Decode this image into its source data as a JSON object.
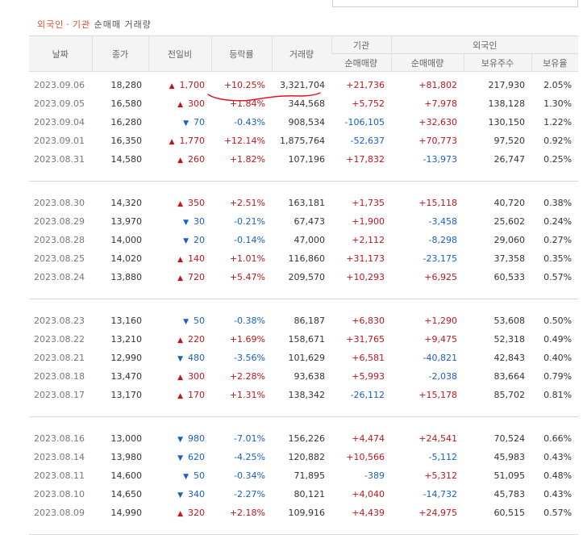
{
  "caption": {
    "part1": "외국인",
    "sep": "·",
    "part2": "기관",
    "rest": "순매매 거래량"
  },
  "columns": {
    "date": "날짜",
    "close": "종가",
    "change": "전일비",
    "rate": "등락률",
    "volume": "거래량",
    "inst_group": "기관",
    "inst_net": "순매매량",
    "foreign_group": "외국인",
    "foreign_net": "순매매량",
    "foreign_hold": "보유주수",
    "foreign_ratio": "보유율"
  },
  "groups": [
    [
      {
        "date": "2023.09.06",
        "close": "18,280",
        "dir": "up",
        "change": "1,700",
        "rate": "+10.25%",
        "volume": "3,321,704",
        "inst": "+21,736",
        "foreign": "+81,802",
        "hold": "217,930",
        "ratio": "2.05%"
      },
      {
        "date": "2023.09.05",
        "close": "16,580",
        "dir": "up",
        "change": "300",
        "rate": "+1.84%",
        "volume": "344,568",
        "inst": "+5,752",
        "foreign": "+7,978",
        "hold": "138,128",
        "ratio": "1.30%"
      },
      {
        "date": "2023.09.04",
        "close": "16,280",
        "dir": "down",
        "change": "70",
        "rate": "-0.43%",
        "volume": "908,534",
        "inst": "-106,105",
        "foreign": "+32,630",
        "hold": "130,150",
        "ratio": "1.22%"
      },
      {
        "date": "2023.09.01",
        "close": "16,350",
        "dir": "up",
        "change": "1,770",
        "rate": "+12.14%",
        "volume": "1,875,764",
        "inst": "-52,637",
        "foreign": "+70,773",
        "hold": "97,520",
        "ratio": "0.92%"
      },
      {
        "date": "2023.08.31",
        "close": "14,580",
        "dir": "up",
        "change": "260",
        "rate": "+1.82%",
        "volume": "107,196",
        "inst": "+17,832",
        "foreign": "-13,973",
        "hold": "26,747",
        "ratio": "0.25%"
      }
    ],
    [
      {
        "date": "2023.08.30",
        "close": "14,320",
        "dir": "up",
        "change": "350",
        "rate": "+2.51%",
        "volume": "163,181",
        "inst": "+1,735",
        "foreign": "+15,118",
        "hold": "40,720",
        "ratio": "0.38%"
      },
      {
        "date": "2023.08.29",
        "close": "13,970",
        "dir": "down",
        "change": "30",
        "rate": "-0.21%",
        "volume": "67,473",
        "inst": "+1,900",
        "foreign": "-3,458",
        "hold": "25,602",
        "ratio": "0.24%"
      },
      {
        "date": "2023.08.28",
        "close": "14,000",
        "dir": "down",
        "change": "20",
        "rate": "-0.14%",
        "volume": "47,000",
        "inst": "+2,112",
        "foreign": "-8,298",
        "hold": "29,060",
        "ratio": "0.27%"
      },
      {
        "date": "2023.08.25",
        "close": "14,020",
        "dir": "up",
        "change": "140",
        "rate": "+1.01%",
        "volume": "116,860",
        "inst": "+31,173",
        "foreign": "-23,175",
        "hold": "37,358",
        "ratio": "0.35%"
      },
      {
        "date": "2023.08.24",
        "close": "13,880",
        "dir": "up",
        "change": "720",
        "rate": "+5.47%",
        "volume": "209,570",
        "inst": "+10,293",
        "foreign": "+6,925",
        "hold": "60,533",
        "ratio": "0.57%"
      }
    ],
    [
      {
        "date": "2023.08.23",
        "close": "13,160",
        "dir": "down",
        "change": "50",
        "rate": "-0.38%",
        "volume": "86,187",
        "inst": "+6,830",
        "foreign": "+1,290",
        "hold": "53,608",
        "ratio": "0.50%"
      },
      {
        "date": "2023.08.22",
        "close": "13,210",
        "dir": "up",
        "change": "220",
        "rate": "+1.69%",
        "volume": "158,671",
        "inst": "+31,765",
        "foreign": "+9,475",
        "hold": "52,318",
        "ratio": "0.49%"
      },
      {
        "date": "2023.08.21",
        "close": "12,990",
        "dir": "down",
        "change": "480",
        "rate": "-3.56%",
        "volume": "101,629",
        "inst": "+6,581",
        "foreign": "-40,821",
        "hold": "42,843",
        "ratio": "0.40%"
      },
      {
        "date": "2023.08.18",
        "close": "13,470",
        "dir": "up",
        "change": "300",
        "rate": "+2.28%",
        "volume": "93,638",
        "inst": "+5,993",
        "foreign": "-2,038",
        "hold": "83,664",
        "ratio": "0.79%"
      },
      {
        "date": "2023.08.17",
        "close": "13,170",
        "dir": "up",
        "change": "170",
        "rate": "+1.31%",
        "volume": "138,342",
        "inst": "-26,112",
        "foreign": "+15,178",
        "hold": "85,702",
        "ratio": "0.81%"
      }
    ],
    [
      {
        "date": "2023.08.16",
        "close": "13,000",
        "dir": "down",
        "change": "980",
        "rate": "-7.01%",
        "volume": "156,226",
        "inst": "+4,474",
        "foreign": "+24,541",
        "hold": "70,524",
        "ratio": "0.66%"
      },
      {
        "date": "2023.08.14",
        "close": "13,980",
        "dir": "down",
        "change": "620",
        "rate": "-4.25%",
        "volume": "120,882",
        "inst": "+10,566",
        "foreign": "-5,112",
        "hold": "45,983",
        "ratio": "0.43%"
      },
      {
        "date": "2023.08.11",
        "close": "14,600",
        "dir": "down",
        "change": "50",
        "rate": "-0.34%",
        "volume": "71,895",
        "inst": "-389",
        "foreign": "+5,312",
        "hold": "51,095",
        "ratio": "0.48%"
      },
      {
        "date": "2023.08.10",
        "close": "14,650",
        "dir": "down",
        "change": "340",
        "rate": "-2.27%",
        "volume": "80,121",
        "inst": "+4,040",
        "foreign": "-14,732",
        "hold": "45,783",
        "ratio": "0.43%"
      },
      {
        "date": "2023.08.09",
        "close": "14,990",
        "dir": "up",
        "change": "320",
        "rate": "+2.18%",
        "volume": "109,916",
        "inst": "+4,439",
        "foreign": "+24,975",
        "hold": "60,515",
        "ratio": "0.57%"
      }
    ]
  ],
  "colors": {
    "up": "#c0161b",
    "down": "#1760c4",
    "accent": "#e34c26",
    "header_bg": "#f4f4f4",
    "annotation": "#e0141e"
  },
  "icons": {
    "up": "up-triangle-icon",
    "down": "down-triangle-icon"
  }
}
